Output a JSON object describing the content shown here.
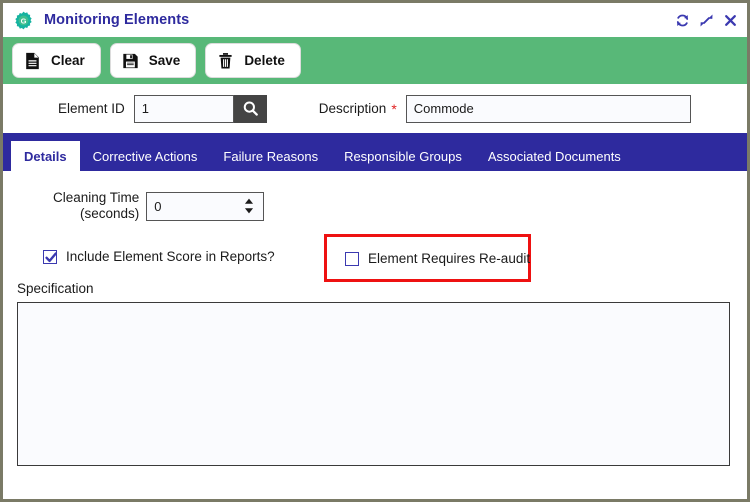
{
  "window": {
    "title": "Monitoring Elements",
    "app_icon": "gear-icon",
    "controls": [
      {
        "name": "refresh-icon",
        "label": "Refresh"
      },
      {
        "name": "expand-icon",
        "label": "Expand"
      },
      {
        "name": "close-icon",
        "label": "Close"
      }
    ]
  },
  "toolbar": {
    "background": "#58b878",
    "buttons": [
      {
        "name": "clear-button",
        "label": "Clear",
        "icon": "document-icon"
      },
      {
        "name": "save-button",
        "label": "Save",
        "icon": "floppy-disk-icon"
      },
      {
        "name": "delete-button",
        "label": "Delete",
        "icon": "trash-icon"
      }
    ]
  },
  "fields": {
    "element_id": {
      "label": "Element ID",
      "value": "1",
      "placeholder": "",
      "search_icon": "search-icon"
    },
    "description": {
      "label": "Description",
      "required_marker": "*",
      "value": "Commode",
      "placeholder": ""
    }
  },
  "tabs": {
    "accent": "#2e2a9e",
    "items": [
      {
        "label": "Details",
        "active": true
      },
      {
        "label": "Corrective Actions",
        "active": false
      },
      {
        "label": "Failure Reasons",
        "active": false
      },
      {
        "label": "Responsible Groups",
        "active": false
      },
      {
        "label": "Associated Documents",
        "active": false
      }
    ]
  },
  "details": {
    "cleaning_time": {
      "label_line1": "Cleaning Time",
      "label_line2": "(seconds)",
      "value": "0"
    },
    "include_score": {
      "label": "Include Element Score in Reports?",
      "checked": true
    },
    "requires_reaudit": {
      "label": "Element Requires Re-audit",
      "checked": false,
      "highlight_color": "#ee1111"
    },
    "specification": {
      "label": "Specification",
      "value": "",
      "placeholder": ""
    }
  }
}
